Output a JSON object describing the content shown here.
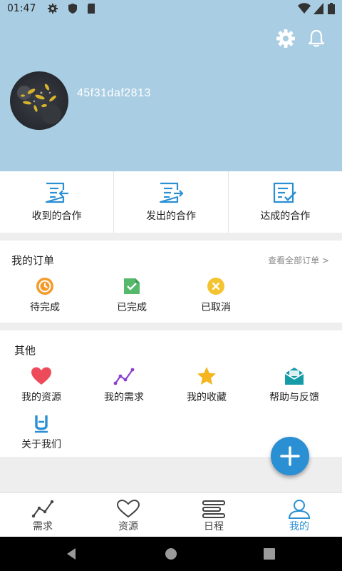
{
  "status_bar": {
    "time": "01:47"
  },
  "profile": {
    "username": "45f31daf2813"
  },
  "cooperation": [
    {
      "label": "收到的合作",
      "icon": "inbox-cooperation-icon"
    },
    {
      "label": "发出的合作",
      "icon": "sent-cooperation-icon"
    },
    {
      "label": "达成的合作",
      "icon": "completed-cooperation-icon"
    }
  ],
  "orders": {
    "title": "我的订单",
    "view_all": "查看全部订单 >",
    "items": [
      {
        "label": "待完成",
        "icon": "clock-icon",
        "color": "#f49a2b"
      },
      {
        "label": "已完成",
        "icon": "check-document-icon",
        "color": "#55b86a"
      },
      {
        "label": "已取消",
        "icon": "cancel-icon",
        "color": "#f4c430"
      }
    ]
  },
  "other": {
    "title": "其他",
    "items": [
      {
        "label": "我的资源",
        "icon": "heart-icon",
        "color": "#ee4b5a"
      },
      {
        "label": "我的需求",
        "icon": "trend-line-icon",
        "color": "#8a3fd0"
      },
      {
        "label": "我的收藏",
        "icon": "star-icon",
        "color": "#f4b51e"
      },
      {
        "label": "帮助与反馈",
        "icon": "mail-icon",
        "color": "#159aa8"
      },
      {
        "label": "关于我们",
        "icon": "about-logo-icon",
        "color": "#2a8fd3"
      }
    ]
  },
  "tabs": [
    {
      "label": "需求",
      "icon": "trend-line-icon"
    },
    {
      "label": "资源",
      "icon": "heart-outline-icon"
    },
    {
      "label": "日程",
      "icon": "schedule-icon"
    },
    {
      "label": "我的",
      "icon": "person-icon",
      "active": true
    }
  ],
  "colors": {
    "header_bg": "#a9cde2",
    "accent": "#2a8fd3"
  }
}
